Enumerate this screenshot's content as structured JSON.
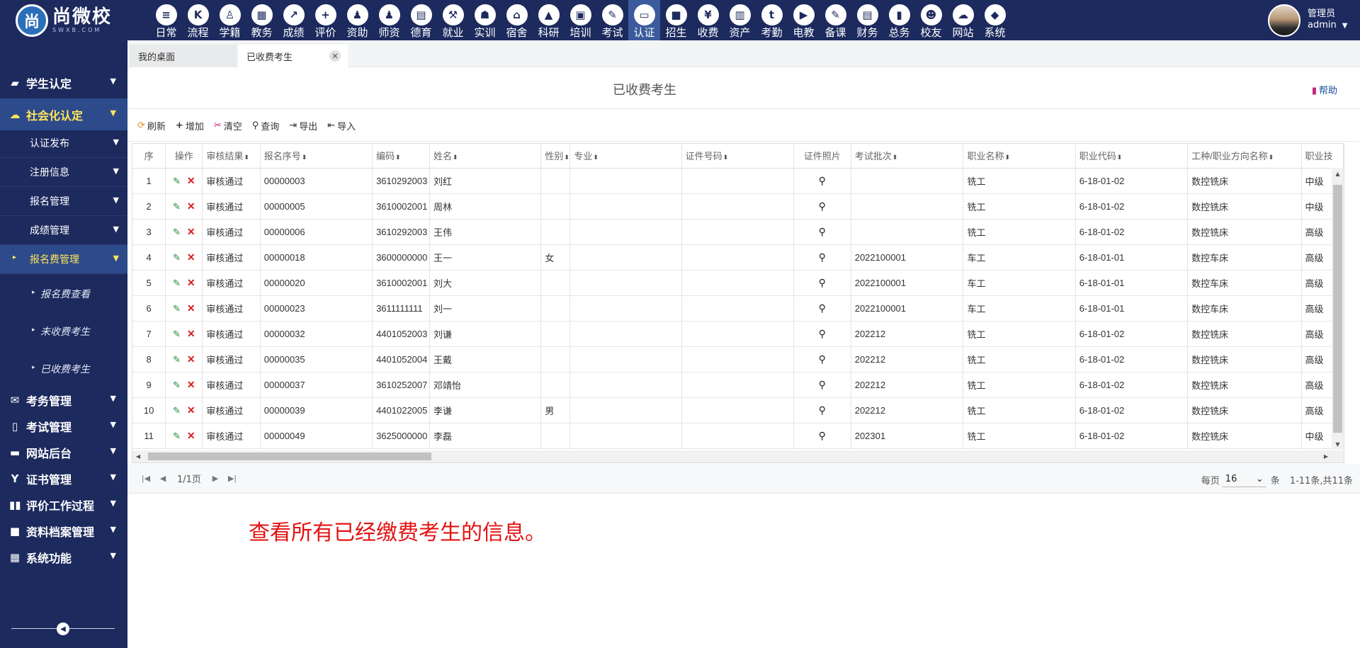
{
  "logo": {
    "mark": "尚",
    "name": "尚微校",
    "domain": "SWXB.COM"
  },
  "nav": [
    {
      "label": "日常",
      "icon": "document-icon",
      "glyph": "≡"
    },
    {
      "label": "流程",
      "icon": "flow-icon",
      "glyph": "K"
    },
    {
      "label": "学籍",
      "icon": "student-icon",
      "glyph": "♙"
    },
    {
      "label": "教务",
      "icon": "calendar-icon",
      "glyph": "▦"
    },
    {
      "label": "成绩",
      "icon": "chart-icon",
      "glyph": "↗"
    },
    {
      "label": "评价",
      "icon": "calendar-plus-icon",
      "glyph": "+"
    },
    {
      "label": "资助",
      "icon": "person-icon",
      "glyph": "♟"
    },
    {
      "label": "师资",
      "icon": "teacher-icon",
      "glyph": "♟"
    },
    {
      "label": "德育",
      "icon": "book-icon",
      "glyph": "▤"
    },
    {
      "label": "就业",
      "icon": "gavel-icon",
      "glyph": "⚒"
    },
    {
      "label": "实训",
      "icon": "robot-icon",
      "glyph": "☗"
    },
    {
      "label": "宿舍",
      "icon": "home-icon",
      "glyph": "⌂"
    },
    {
      "label": "科研",
      "icon": "graduation-cap-icon",
      "glyph": "▲"
    },
    {
      "label": "培训",
      "icon": "image-icon",
      "glyph": "▣"
    },
    {
      "label": "考试",
      "icon": "wrench-icon",
      "glyph": "✎"
    },
    {
      "label": "认证",
      "icon": "monitor-icon",
      "glyph": "▭"
    },
    {
      "label": "招生",
      "icon": "bus-icon",
      "glyph": "■"
    },
    {
      "label": "收费",
      "icon": "yen-icon",
      "glyph": "¥"
    },
    {
      "label": "资产",
      "icon": "train-icon",
      "glyph": "▥"
    },
    {
      "label": "考勤",
      "icon": "tumblr-icon",
      "glyph": "t"
    },
    {
      "label": "电教",
      "icon": "video-icon",
      "glyph": "▶"
    },
    {
      "label": "备课",
      "icon": "edit-icon",
      "glyph": "✎"
    },
    {
      "label": "财务",
      "icon": "newspaper-icon",
      "glyph": "▤"
    },
    {
      "label": "总务",
      "icon": "bar-chart-icon",
      "glyph": "▮"
    },
    {
      "label": "校友",
      "icon": "users-icon",
      "glyph": "☻"
    },
    {
      "label": "网站",
      "icon": "cloud-icon",
      "glyph": "☁"
    },
    {
      "label": "系统",
      "icon": "cube-icon",
      "glyph": "◆"
    }
  ],
  "nav_active": "认证",
  "user": {
    "role": "管理员",
    "name": "admin"
  },
  "sidebar": {
    "groups": [
      {
        "label": "学生认定",
        "icon": "book-icon",
        "glyph": "▰"
      },
      {
        "label": "社会化认定",
        "icon": "cloud-icon",
        "glyph": "☁"
      },
      {
        "label": "考务管理",
        "icon": "envelope-icon",
        "glyph": "✉"
      },
      {
        "label": "考试管理",
        "icon": "file-icon",
        "glyph": "▯"
      },
      {
        "label": "网站后台",
        "icon": "folder-icon",
        "glyph": "▬"
      },
      {
        "label": "证书管理",
        "icon": "certificate-icon",
        "glyph": "Y"
      },
      {
        "label": "评价工作过程",
        "icon": "columns-icon",
        "glyph": "▮▮"
      },
      {
        "label": "资料档案管理",
        "icon": "square-icon",
        "glyph": "■"
      },
      {
        "label": "系统功能",
        "icon": "grid-icon",
        "glyph": "▦"
      }
    ],
    "subs": [
      "认证发布",
      "注册信息",
      "报名管理",
      "成绩管理",
      "报名费管理"
    ],
    "leaves": [
      "报名费查看",
      "未收费考生",
      "已收费考生"
    ]
  },
  "tabs": {
    "home": "我的桌面",
    "current": "已收费考生"
  },
  "page": {
    "title": "已收费考生",
    "help": "帮助"
  },
  "toolbar": {
    "refresh": "刷新",
    "add": "增加",
    "clear": "清空",
    "query": "查询",
    "export": "导出",
    "import": "导入"
  },
  "table": {
    "headers": {
      "seq": "序",
      "op": "操作",
      "audit": "审核结果",
      "regno": "报名序号",
      "code": "编码",
      "name": "姓名",
      "gender": "性别",
      "major": "专业",
      "idno": "证件号码",
      "photo": "证件照片",
      "batch": "考试批次",
      "job": "职业名称",
      "jobcode": "职业代码",
      "work": "工种/职业方向名称",
      "level": "职业技"
    },
    "rows": [
      {
        "seq": "1",
        "audit": "审核通过",
        "regno": "00000003",
        "code": "3610292003",
        "name": "刘红",
        "gender": "",
        "major": "",
        "idno": "",
        "batch": "",
        "job": "铣工",
        "jobcode": "6-18-01-02",
        "work": "数控铣床",
        "level": "中级"
      },
      {
        "seq": "2",
        "audit": "审核通过",
        "regno": "00000005",
        "code": "3610002001",
        "name": "周林",
        "gender": "",
        "major": "",
        "idno": "",
        "batch": "",
        "job": "铣工",
        "jobcode": "6-18-01-02",
        "work": "数控铣床",
        "level": "中级"
      },
      {
        "seq": "3",
        "audit": "审核通过",
        "regno": "00000006",
        "code": "3610292003",
        "name": "王伟",
        "gender": "",
        "major": "",
        "idno": "",
        "batch": "",
        "job": "铣工",
        "jobcode": "6-18-01-02",
        "work": "数控铣床",
        "level": "高级"
      },
      {
        "seq": "4",
        "audit": "审核通过",
        "regno": "00000018",
        "code": "3600000000",
        "name": "王一",
        "gender": "女",
        "major": "",
        "idno": "",
        "batch": "2022100001",
        "job": "车工",
        "jobcode": "6-18-01-01",
        "work": "数控车床",
        "level": "高级"
      },
      {
        "seq": "5",
        "audit": "审核通过",
        "regno": "00000020",
        "code": "3610002001",
        "name": "刘大",
        "gender": "",
        "major": "",
        "idno": "",
        "batch": "2022100001",
        "job": "车工",
        "jobcode": "6-18-01-01",
        "work": "数控车床",
        "level": "高级"
      },
      {
        "seq": "6",
        "audit": "审核通过",
        "regno": "00000023",
        "code": "3611111111",
        "name": "刘一",
        "gender": "",
        "major": "",
        "idno": "",
        "batch": "2022100001",
        "job": "车工",
        "jobcode": "6-18-01-01",
        "work": "数控车床",
        "level": "高级"
      },
      {
        "seq": "7",
        "audit": "审核通过",
        "regno": "00000032",
        "code": "4401052003",
        "name": "刘谦",
        "gender": "",
        "major": "",
        "idno": "",
        "batch": "202212",
        "job": "铣工",
        "jobcode": "6-18-01-02",
        "work": "数控铣床",
        "level": "高级"
      },
      {
        "seq": "8",
        "audit": "审核通过",
        "regno": "00000035",
        "code": "4401052004",
        "name": "王戴",
        "gender": "",
        "major": "",
        "idno": "",
        "batch": "202212",
        "job": "铣工",
        "jobcode": "6-18-01-02",
        "work": "数控铣床",
        "level": "高级"
      },
      {
        "seq": "9",
        "audit": "审核通过",
        "regno": "00000037",
        "code": "3610252007",
        "name": "邓靖怡",
        "gender": "",
        "major": "",
        "idno": "",
        "batch": "202212",
        "job": "铣工",
        "jobcode": "6-18-01-02",
        "work": "数控铣床",
        "level": "高级"
      },
      {
        "seq": "10",
        "audit": "审核通过",
        "regno": "00000039",
        "code": "4401022005",
        "name": "李谦",
        "gender": "男",
        "major": "",
        "idno": "",
        "batch": "202212",
        "job": "铣工",
        "jobcode": "6-18-01-02",
        "work": "数控铣床",
        "level": "高级"
      },
      {
        "seq": "11",
        "audit": "审核通过",
        "regno": "00000049",
        "code": "3625000000",
        "name": "李磊",
        "gender": "",
        "major": "",
        "idno": "",
        "batch": "202301",
        "job": "铣工",
        "jobcode": "6-18-01-02",
        "work": "数控铣床",
        "level": "中级"
      }
    ]
  },
  "pager": {
    "page_info": "1/1页",
    "per_page_label": "每页",
    "per_page": "16",
    "unit": "条",
    "total": "1-11条,共11条"
  },
  "note": "查看所有已经缴费考生的信息。",
  "colors": {
    "nav_bg": "#1c2a5e",
    "active_bg": "#2d4a8a",
    "highlight": "#ffe55c",
    "note": "#e41212"
  }
}
